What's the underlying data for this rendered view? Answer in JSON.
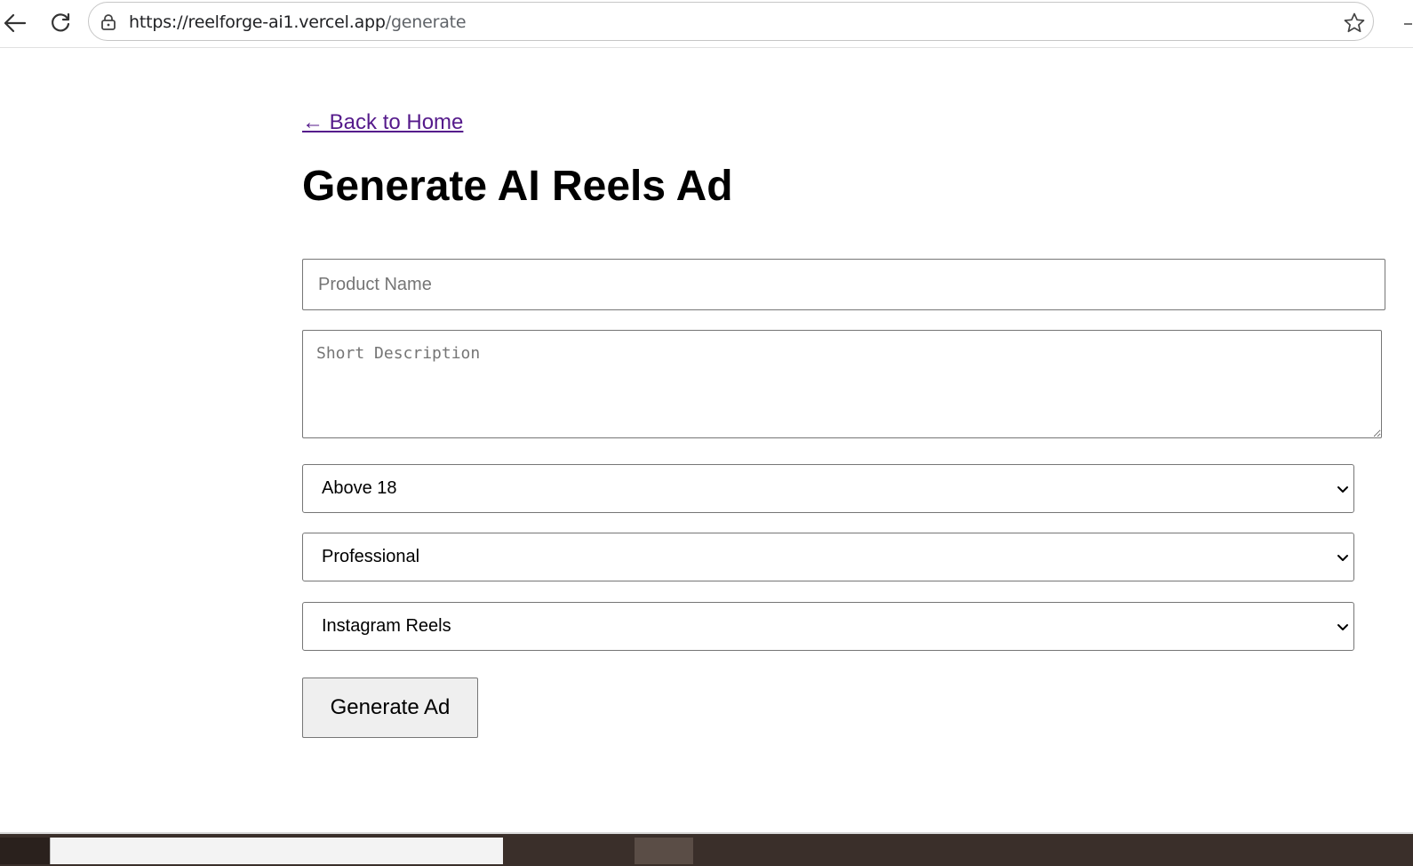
{
  "browser": {
    "url_host": "https://reelforge-ai1.vercel.app",
    "url_path": "/generate"
  },
  "page": {
    "back_link": "← Back to Home",
    "title": "Generate AI Reels Ad"
  },
  "form": {
    "product_name_placeholder": "Product Name",
    "product_name_value": "",
    "description_placeholder": "Short Description",
    "description_value": "",
    "age_selected": "Above 18",
    "tone_selected": "Professional",
    "platform_selected": "Instagram Reels",
    "submit_label": "Generate Ad"
  },
  "icons": {
    "back": "arrow-left-icon",
    "reload": "reload-icon",
    "lock": "lock-icon",
    "star": "star-icon",
    "chevron": "chevron-down-icon"
  },
  "colors": {
    "link": "#551a8b",
    "button_bg": "#efefef",
    "border": "#767676"
  }
}
